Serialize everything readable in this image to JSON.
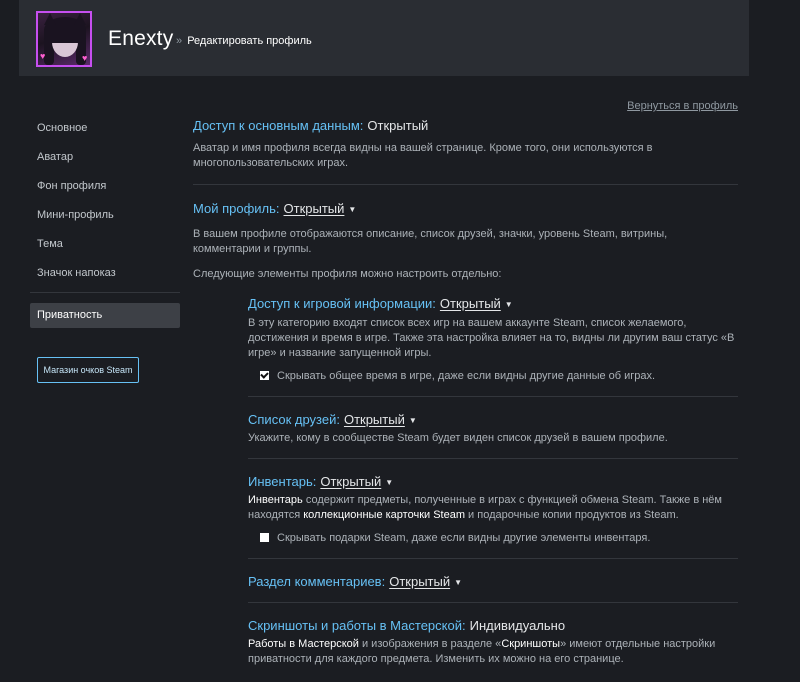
{
  "header": {
    "username": "Enexty",
    "breadcrumb_sep": "»",
    "breadcrumb": "Редактировать профиль"
  },
  "back_link": "Вернуться в профиль",
  "sidebar": {
    "items": [
      {
        "label": "Основное"
      },
      {
        "label": "Аватар"
      },
      {
        "label": "Фон профиля"
      },
      {
        "label": "Мини-профиль"
      },
      {
        "label": "Тема"
      },
      {
        "label": "Значок напоказ"
      },
      {
        "label": "Приватность",
        "active": true
      }
    ],
    "points_button": "Магазин очков Steam"
  },
  "sections": {
    "basic": {
      "title": "Доступ к основным данным:",
      "value": "Открытый",
      "description": "Аватар и имя профиля всегда видны на вашей странице. Кроме того, они используются в многопользовательских играх."
    },
    "profile": {
      "title": "Мой профиль:",
      "value": "Открытый",
      "description": "В вашем профиле отображаются описание, список друзей, значки, уровень Steam, витрины, комментарии и группы.",
      "note": "Следующие элементы профиля можно настроить отдельно:"
    },
    "game_info": {
      "title": "Доступ к игровой информации:",
      "value": "Открытый",
      "description": "В эту категорию входят список всех игр на вашем аккаунте Steam, список желаемого, достижения и время в игре. Также эта настройка влияет на то, видны ли другим ваш статус «В игре» и название запущенной игры.",
      "checkbox_label": "Скрывать общее время в игре, даже если видны другие данные об играх.",
      "checkbox_checked": true
    },
    "friends": {
      "title": "Список друзей:",
      "value": "Открытый",
      "description": "Укажите, кому в сообществе Steam будет виден список друзей в вашем профиле."
    },
    "inventory": {
      "title": "Инвентарь:",
      "value": "Открытый",
      "desc_hl1": "Инвентарь",
      "desc_part1": " содержит предметы, полученные в играх с функцией обмена Steam. Также в нём находятся ",
      "desc_hl2": "коллекционные карточки Steam",
      "desc_part2": " и подарочные копии продуктов из Steam.",
      "checkbox_label": "Скрывать подарки Steam, даже если видны другие элементы инвентаря.",
      "checkbox_checked": false
    },
    "comments": {
      "title": "Раздел комментариев:",
      "value": "Открытый"
    },
    "screenshots": {
      "title": "Скриншоты и работы в Мастерской:",
      "value": "Индивидуально",
      "desc_hl1": "Работы в Мастерской",
      "desc_part1": " и изображения в разделе «",
      "desc_hl2": "Скриншоты",
      "desc_part2": "» имеют отдельные настройки приватности для каждого предмета. Изменить их можно на его странице."
    }
  }
}
